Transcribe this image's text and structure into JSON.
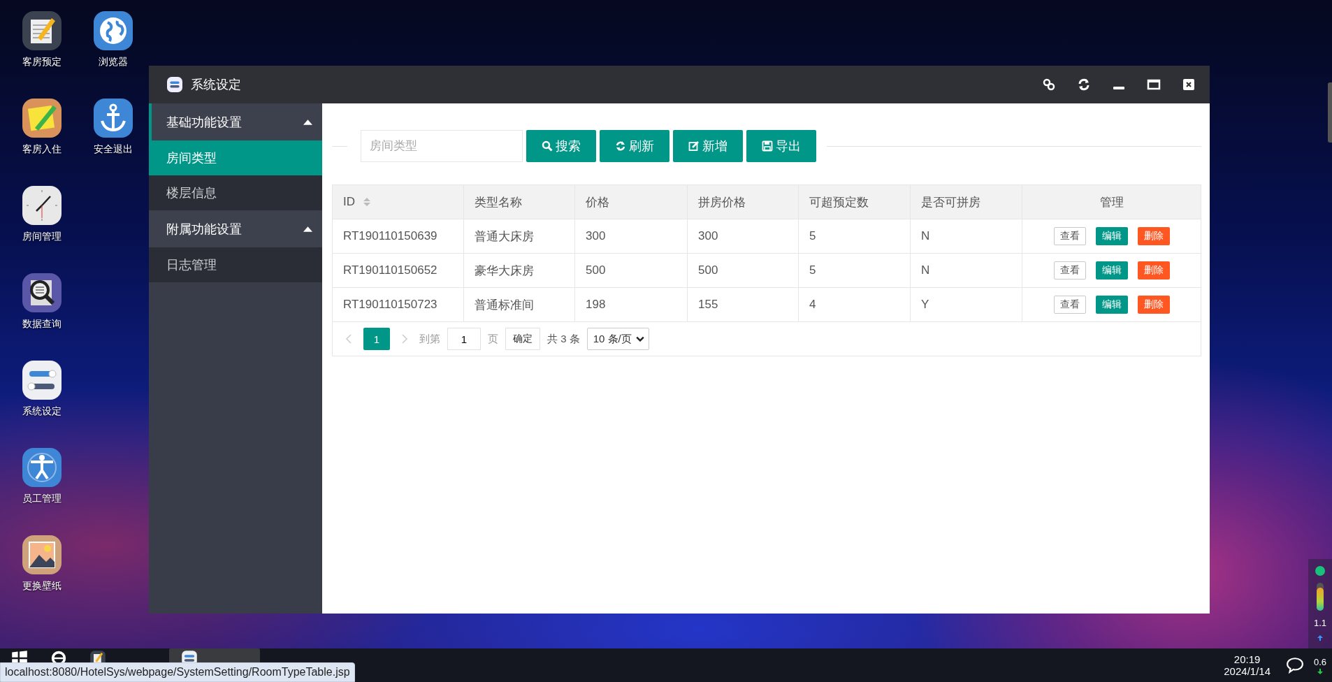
{
  "desktop_icons": [
    {
      "label": "客房预定",
      "kind": "notepad"
    },
    {
      "label": "浏览器",
      "kind": "globe"
    },
    {
      "label": "客房入住",
      "kind": "sticky-note"
    },
    {
      "label": "安全退出",
      "kind": "anchor"
    },
    {
      "label": "房间管理",
      "kind": "clock"
    },
    {
      "label": "数据查询",
      "kind": "magnifier"
    },
    {
      "label": "系统设定",
      "kind": "toggles"
    },
    {
      "label": "员工管理",
      "kind": "person"
    },
    {
      "label": "更换壁纸",
      "kind": "landscape"
    }
  ],
  "window": {
    "title": "系统设定"
  },
  "sidebar": {
    "groups": [
      {
        "label": "基础功能设置",
        "expanded": true,
        "items": [
          {
            "label": "房间类型",
            "selected": true
          },
          {
            "label": "楼层信息",
            "selected": false
          }
        ]
      },
      {
        "label": "附属功能设置",
        "expanded": true,
        "items": [
          {
            "label": "日志管理",
            "selected": false
          }
        ]
      }
    ]
  },
  "toolbar": {
    "search": {
      "placeholder": "房间类型"
    },
    "buttons": [
      {
        "label": "搜索",
        "kind": "search"
      },
      {
        "label": "刷新",
        "kind": "refresh"
      },
      {
        "label": "新增",
        "kind": "add"
      },
      {
        "label": "导出",
        "kind": "export"
      }
    ]
  },
  "table": {
    "columns": [
      {
        "label": "ID",
        "sortable": true
      },
      {
        "label": "类型名称",
        "sortable": false
      },
      {
        "label": "价格",
        "sortable": false
      },
      {
        "label": "拼房价格",
        "sortable": false
      },
      {
        "label": "可超预定数",
        "sortable": false
      },
      {
        "label": "是否可拼房",
        "sortable": false
      },
      {
        "label": "管理",
        "sortable": false
      }
    ],
    "rows": [
      {
        "cells": [
          "RT190110150639",
          "普通大床房",
          "300",
          "300",
          "5",
          "N"
        ],
        "actions": [
          {
            "label": "查看",
            "kind": "view"
          },
          {
            "label": "编辑",
            "kind": "edit"
          },
          {
            "label": "删除",
            "kind": "delete"
          }
        ]
      },
      {
        "cells": [
          "RT190110150652",
          "豪华大床房",
          "500",
          "500",
          "5",
          "N"
        ],
        "actions": [
          {
            "label": "查看",
            "kind": "view"
          },
          {
            "label": "编辑",
            "kind": "edit"
          },
          {
            "label": "删除",
            "kind": "delete"
          }
        ]
      },
      {
        "cells": [
          "RT190110150723",
          "普通标准间",
          "198",
          "155",
          "4",
          "Y"
        ],
        "actions": [
          {
            "label": "查看",
            "kind": "view"
          },
          {
            "label": "编辑",
            "kind": "edit"
          },
          {
            "label": "删除",
            "kind": "delete"
          }
        ]
      }
    ]
  },
  "pagination": {
    "pages": [
      {
        "label": "1",
        "selected": true
      }
    ],
    "goto_label": "到第",
    "goto_value": "1",
    "page_unit": "页",
    "confirm": "确定",
    "total": "共 3 条",
    "page_size": "10 条/页"
  },
  "taskbar": {
    "items": [
      {
        "kind": "start",
        "selected": false
      },
      {
        "kind": "browser",
        "selected": false
      },
      {
        "kind": "notepad",
        "selected": false
      },
      {
        "kind": "toggles",
        "selected": true
      }
    ],
    "time": "20:19",
    "date": "2024/1/14",
    "net_up": "1.1",
    "net_down": "0.6"
  },
  "status_url": "localhost:8080/HotelSys/webpage/SystemSetting/RoomTypeTable.jsp"
}
